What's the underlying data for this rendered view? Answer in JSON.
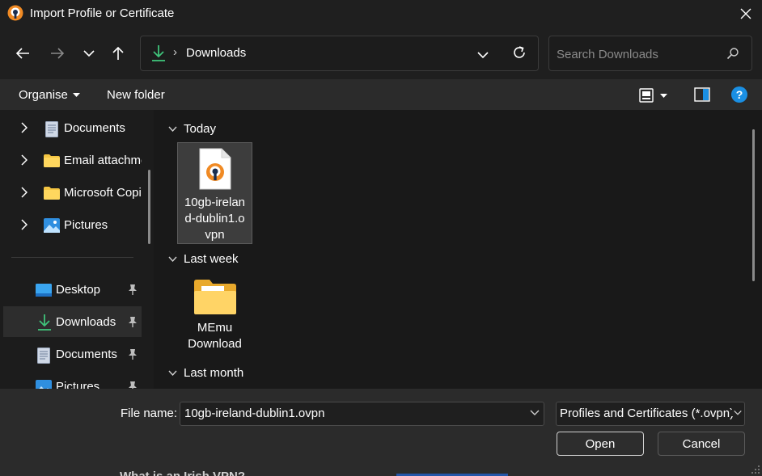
{
  "window": {
    "title": "Import Profile or Certificate",
    "icon": "openvpn-logo-icon"
  },
  "nav": {
    "back": "back-arrow-icon",
    "forward": "forward-arrow-icon",
    "recent": "chevron-down-icon",
    "up": "up-arrow-icon"
  },
  "address": {
    "icon": "downloads-icon",
    "separator": "›",
    "location": "Downloads"
  },
  "search": {
    "placeholder": "Search Downloads"
  },
  "toolbar": {
    "organise": "Organise",
    "new_folder": "New folder"
  },
  "sidebar": {
    "tree": [
      {
        "label": "Documents",
        "icon": "documents-icon"
      },
      {
        "label": "Email attachments",
        "icon": "folder-icon"
      },
      {
        "label": "Microsoft Copilot",
        "icon": "folder-icon"
      },
      {
        "label": "Pictures",
        "icon": "pictures-icon"
      }
    ],
    "quick_access": [
      {
        "label": "Desktop",
        "icon": "desktop-icon",
        "selected": false
      },
      {
        "label": "Downloads",
        "icon": "downloads-icon",
        "selected": true
      },
      {
        "label": "Documents",
        "icon": "documents-icon",
        "selected": false
      },
      {
        "label": "Pictures",
        "icon": "pictures-icon",
        "selected": false
      }
    ]
  },
  "content": {
    "groups": [
      {
        "label": "Today",
        "items": [
          {
            "name": "10gb-ireland-dublin1.ovpn",
            "lines": [
              "10gb-irelan",
              "d-dublin1.o",
              "vpn"
            ],
            "type": "openvpn-file-icon",
            "selected": true
          }
        ]
      },
      {
        "label": "Last week",
        "items": [
          {
            "name": "MEmu Download",
            "lines": [
              "MEmu",
              "Download"
            ],
            "type": "folder-icon",
            "selected": false
          }
        ]
      },
      {
        "label": "Last month",
        "items": []
      }
    ]
  },
  "footer": {
    "file_name_label": "File name:",
    "file_name_value": "10gb-ireland-dublin1.ovpn",
    "file_type_value": "Profiles and Certificates (*.ovpn)",
    "open_label": "Open",
    "cancel_label": "Cancel"
  },
  "background": {
    "bleed_text": "What is an Irish VPN?"
  },
  "colors": {
    "accent": "#0078d4",
    "downloads_green": "#3fc37a",
    "folder_yellow": "#f4c542",
    "help_blue": "#1a8fe3"
  }
}
